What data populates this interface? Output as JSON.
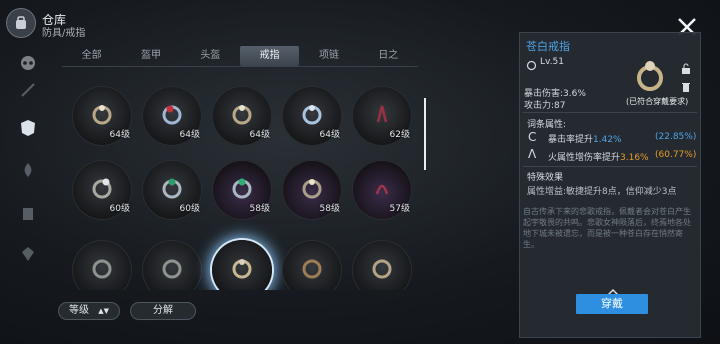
{
  "header": {
    "title": "仓库",
    "subtitle": "防具/戒指",
    "icon": "backpack-icon"
  },
  "rail": [
    "skull-icon",
    "sword-icon",
    "armor-icon",
    "flame-icon",
    "scroll-icon",
    "gem-icon"
  ],
  "tabs": [
    "全部",
    "盔甲",
    "头盔",
    "戒指",
    "项链",
    "日之"
  ],
  "active_tab": 3,
  "grid": {
    "row1": [
      "64级",
      "64级",
      "64级",
      "64级",
      "62级"
    ],
    "row2": [
      "60级",
      "60级",
      "58级",
      "58级",
      "57级"
    ],
    "row3": [
      "",
      "",
      "",
      "",
      ""
    ]
  },
  "buttons": {
    "sort": "等级",
    "decompose": "分解"
  },
  "detail": {
    "title": "苍白戒指",
    "level": "Lv.51",
    "stat1": "暴击伤害:3.6%",
    "stat2": "攻击力:87",
    "note": "(已符合穿戴要求)",
    "affix_header": "词条属性:",
    "affix1_label": "暴击率提升",
    "affix1_value": "1.42%",
    "affix1_pct": "(22.85%)",
    "affix2_label": "火属性增伤率提升",
    "affix2_value": "3.16%",
    "affix2_pct": "(60.77%)",
    "special_header": "特殊效果",
    "special_text": "属性增益:敏捷提升8点，信仰减少3点",
    "desc": "自古传承下来的悲歌戒指，佩戴者会对苍白产生起宇敬畏的共鸣。悲歌女神陨落后，终焉地各处地下城未被遗忘，而是被一种苍白存在悄然寄生。",
    "equip": "穿戴"
  },
  "colors": {
    "accent": "#2e8fe0",
    "title_blue": "#4ea3e6",
    "stat_blue": "#4ea3e6",
    "pct_orange": "#e39b2a"
  }
}
